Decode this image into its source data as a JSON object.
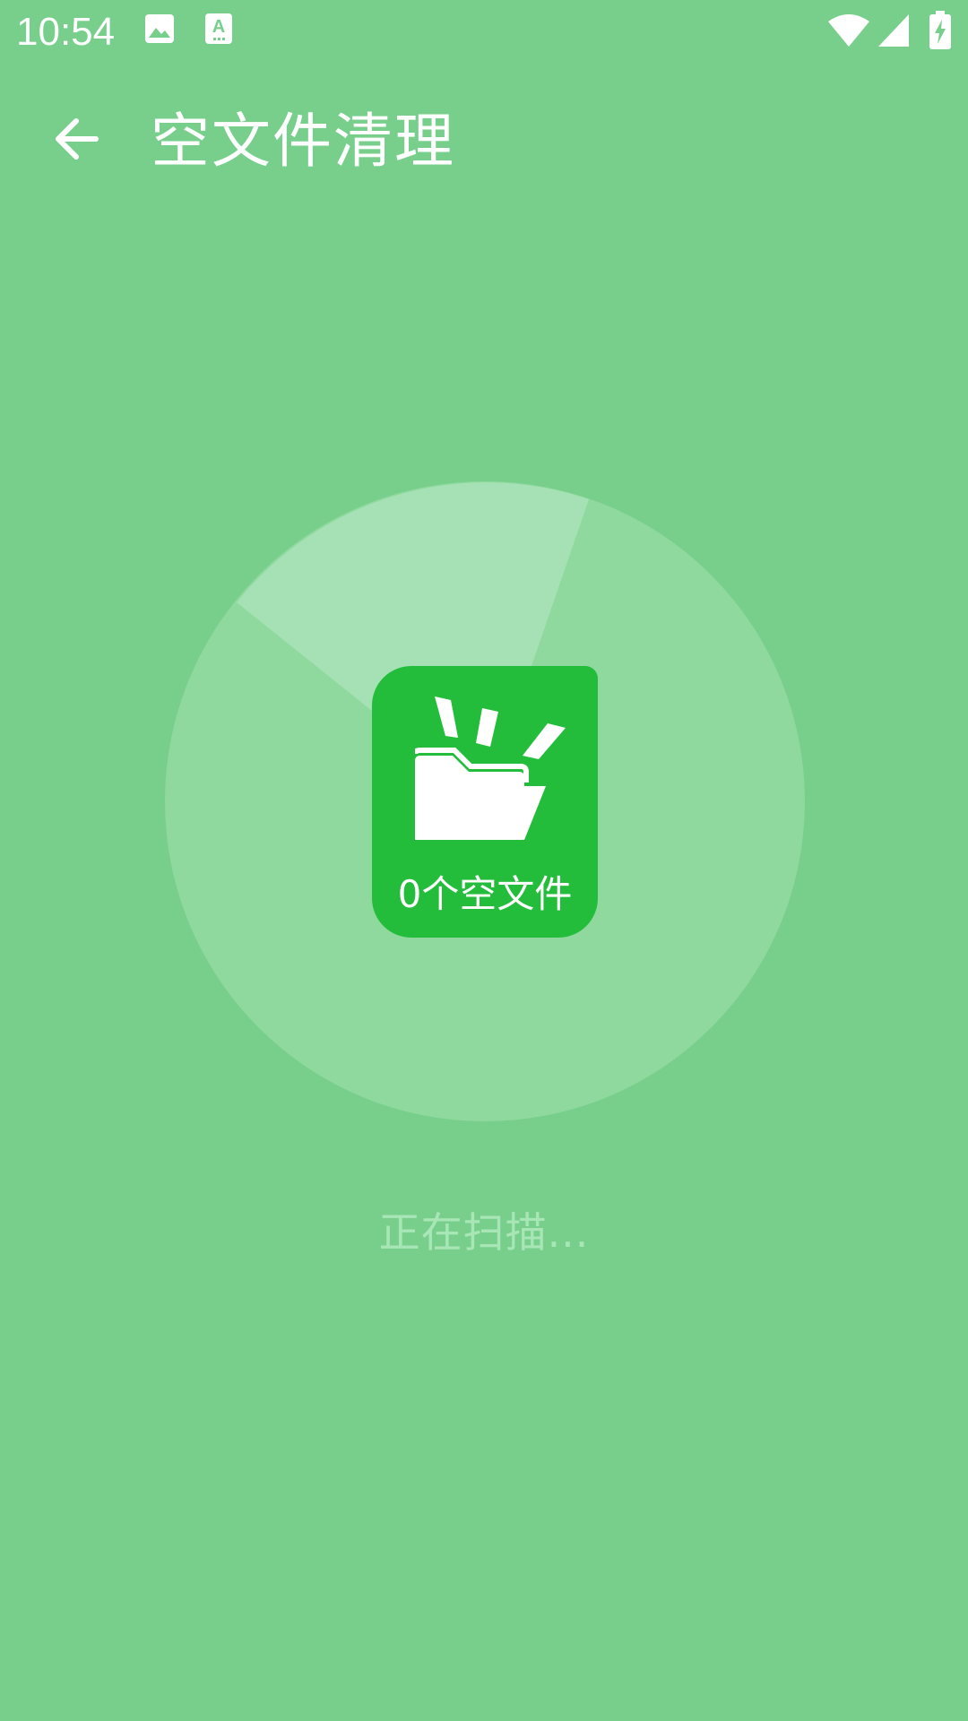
{
  "status_bar": {
    "time": "10:54",
    "icons": [
      "image-icon",
      "text-a-icon",
      "wifi-icon",
      "signal-icon",
      "battery-charging-icon"
    ]
  },
  "app_bar": {
    "back_icon": "arrow-left-icon",
    "title": "空文件清理"
  },
  "scan": {
    "count_label": "0个空文件",
    "status_text": "正在扫描..."
  },
  "colors": {
    "background": "#77cf8b",
    "circle_base": "#8fd99f",
    "circle_sweep": "#a5e1b5",
    "icon_box": "#24bd3b",
    "scanning_text": "#a9e6b7"
  }
}
